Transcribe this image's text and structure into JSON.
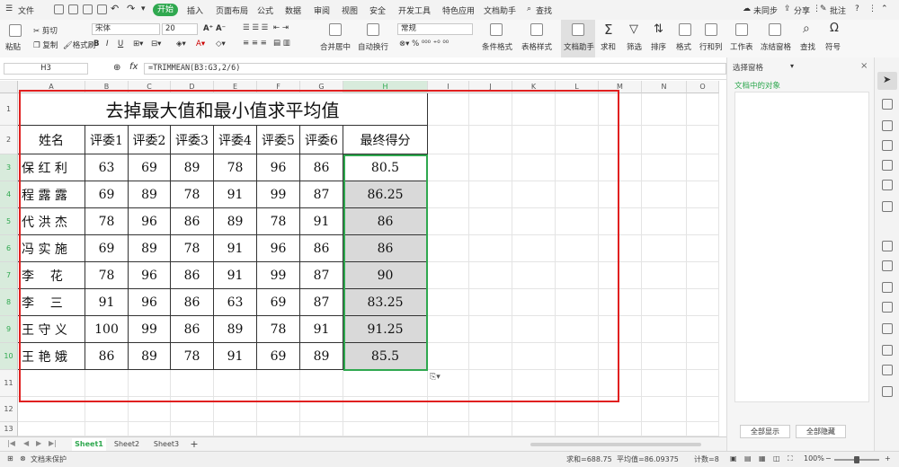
{
  "menubar": {
    "file_label": "文件",
    "tabs": [
      {
        "label": "开始",
        "active": true
      },
      {
        "label": "插入"
      },
      {
        "label": "页面布局"
      },
      {
        "label": "公式"
      },
      {
        "label": "数据"
      },
      {
        "label": "审阅"
      },
      {
        "label": "视图"
      },
      {
        "label": "安全"
      },
      {
        "label": "开发工具"
      },
      {
        "label": "特色应用"
      },
      {
        "label": "文档助手"
      }
    ],
    "search_label": "查找",
    "sync_label": "未同步",
    "share_label": "分享",
    "comment_label": "批注",
    "active_color": "#2fa84f"
  },
  "ribbon": {
    "paste": "粘贴",
    "cut": "剪切",
    "copy": "复制",
    "format_painter": "格式刷",
    "font_name": "宋体",
    "font_size": "20",
    "merge_center": "合并居中",
    "wrap_text": "自动换行",
    "number_format": "常规",
    "conditional_format": "条件格式",
    "table_style": "表格样式",
    "doc_assistant": "文档助手",
    "sum": "求和",
    "filter": "筛选",
    "sort": "排序",
    "format": "格式",
    "row_col": "行和列",
    "worksheet": "工作表",
    "freeze": "冻结窗格",
    "find": "查找",
    "symbol": "符号"
  },
  "formula_bar": {
    "name_box": "H3",
    "fx_label": "fx",
    "formula": "=TRIMMEAN(B3:G3,2/6)"
  },
  "sheet": {
    "columns": [
      "A",
      "B",
      "C",
      "D",
      "E",
      "F",
      "G",
      "H",
      "I",
      "J",
      "K",
      "L",
      "M",
      "N",
      "O"
    ],
    "rows": [
      "1",
      "2",
      "3",
      "4",
      "5",
      "6",
      "7",
      "8",
      "9",
      "10",
      "11",
      "12",
      "13"
    ],
    "title": "去掉最大值和最小值求平均值",
    "headers": [
      "姓名",
      "评委1",
      "评委2",
      "评委3",
      "评委4",
      "评委5",
      "评委6",
      "最终得分"
    ],
    "data": [
      [
        "保 红 利",
        "63",
        "69",
        "89",
        "78",
        "96",
        "86",
        "80.5"
      ],
      [
        "程 露 露",
        "69",
        "89",
        "78",
        "91",
        "99",
        "87",
        "86.25"
      ],
      [
        "代 洪 杰",
        "78",
        "96",
        "86",
        "89",
        "78",
        "91",
        "86"
      ],
      [
        "冯 实 施",
        "69",
        "89",
        "78",
        "91",
        "96",
        "86",
        "86"
      ],
      [
        "李    花",
        "78",
        "96",
        "86",
        "91",
        "99",
        "87",
        "90"
      ],
      [
        "李    三",
        "91",
        "96",
        "86",
        "63",
        "69",
        "87",
        "83.25"
      ],
      [
        "王 守 义",
        "100",
        "99",
        "86",
        "89",
        "78",
        "91",
        "91.25"
      ],
      [
        "王 艳 娥",
        "86",
        "89",
        "78",
        "91",
        "69",
        "89",
        "85.5"
      ]
    ]
  },
  "panel": {
    "title": "选择窗格",
    "subtitle": "文档中的对象",
    "show_all": "全部显示",
    "hide_all": "全部隐藏"
  },
  "sheet_tabs": [
    "Sheet1",
    "Sheet2",
    "Sheet3"
  ],
  "status": {
    "doc_status": "文档未保护",
    "sum": "求和=688.75",
    "avg": "平均值=86.09375",
    "count": "计数=8",
    "zoom": "100%"
  },
  "colors": {
    "highlight_border": "#e02020",
    "selection_green": "#2fa84f",
    "selected_fill": "#d9d9d9"
  }
}
